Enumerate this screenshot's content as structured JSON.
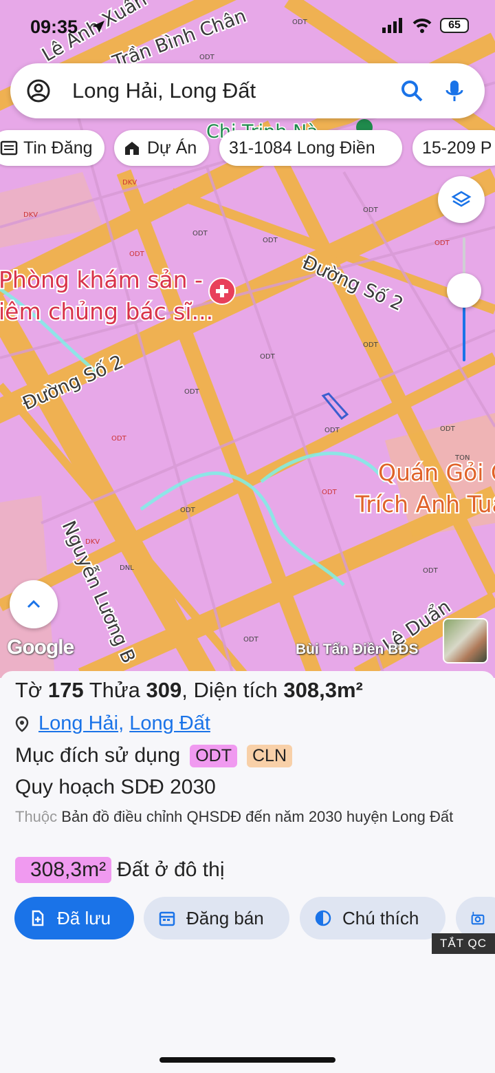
{
  "status_bar": {
    "time": "09:35",
    "battery": "65"
  },
  "search": {
    "query": "Long Hải, Long Đất"
  },
  "chips": [
    {
      "label": "Tin Đăng",
      "icon": "list-icon"
    },
    {
      "label": "Dự Án",
      "icon": "building-icon"
    },
    {
      "label": "31-1084 Long Điền"
    },
    {
      "label": "15-209 P"
    }
  ],
  "map": {
    "street_labels": [
      "Lê Anh Xuân",
      "Trần Bình Chân",
      "Chi Trịnh Nà",
      "Đường Số 2",
      "Đường Số 2",
      "Nguyễn Lương B",
      "Lê Duẩn"
    ],
    "poi": [
      {
        "line1": "Phòng khám sản -",
        "line2": "iêm chủng bác sĩ..."
      },
      {
        "line1": "Quán Gỏi C",
        "line2": "Trích Anh Tuấ"
      }
    ],
    "zone_codes": [
      "ODT",
      "DKV",
      "TON",
      "DNL"
    ],
    "attribution": "Google",
    "owner": "Bùi Tấn Điền BĐS"
  },
  "parcel": {
    "to_label": "Tờ",
    "to_value": "175",
    "thua_label": "Thửa",
    "thua_value": "309",
    "area_label": ", Diện tích",
    "area_value": "308,3m²",
    "locations": [
      "Long Hải",
      "Long Đất"
    ],
    "purpose_label": "Mục đích sử dụng",
    "purpose_tags": [
      "ODT",
      "CLN"
    ],
    "plan_label": "Quy hoạch SDĐ 2030",
    "belongs_prefix": "Thuộc",
    "belongs_text": "Bản đồ điều chỉnh QHSDĐ đến năm 2030 huyện Long Đất",
    "zone_area": "308,3m²",
    "zone_desc": "Đất ở đô thị"
  },
  "actions": [
    {
      "label": "Đã lưu"
    },
    {
      "label": "Đăng bán"
    },
    {
      "label": "Chú thích"
    }
  ],
  "ad_toggle": "TẮT QC",
  "colors": {
    "accent": "#1a73e8",
    "odt_tag": "#f09af0",
    "cln_tag": "#f8d0a8",
    "map_pink": "#e7a8e8",
    "road": "#f0b24a"
  }
}
